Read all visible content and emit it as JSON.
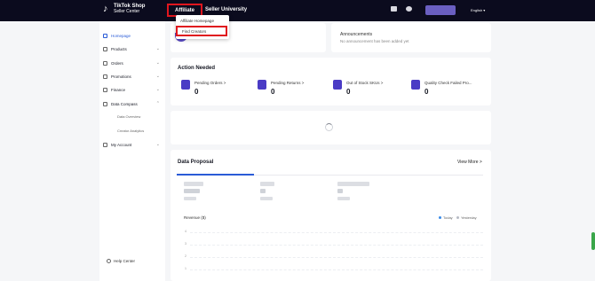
{
  "header": {
    "logo_line1": "TikTok Shop",
    "logo_line2": "Seller Center",
    "logo_mark": "♪",
    "nav": {
      "affiliate": "Affiliate",
      "seller_university": "Seller University"
    },
    "language": "English ▾"
  },
  "affiliate_menu": {
    "items": [
      "Affiliate Homepage",
      "Find Creators"
    ]
  },
  "sidebar": {
    "items": [
      {
        "label": "Homepage",
        "icon": "home-icon"
      },
      {
        "label": "Products",
        "icon": "products-icon"
      },
      {
        "label": "Orders",
        "icon": "orders-icon"
      },
      {
        "label": "Promotions",
        "icon": "promotions-icon"
      },
      {
        "label": "Finance",
        "icon": "finance-icon"
      },
      {
        "label": "Data Compass",
        "icon": "data-compass-icon"
      },
      {
        "label": "My Account",
        "icon": "account-icon"
      }
    ],
    "subitems": [
      "Data Overview",
      "Creator Analytics"
    ],
    "help": "Help Center"
  },
  "announcements": {
    "title": "Announcements",
    "empty_text": "No announcement has been added yet"
  },
  "action_needed": {
    "title": "Action Needed",
    "items": [
      {
        "label": "Pending Orders >",
        "value": "0"
      },
      {
        "label": "Pending Returns >",
        "value": "0"
      },
      {
        "label": "Out of Stock SKUs >",
        "value": "0"
      },
      {
        "label": "Quality Check Failed Pro...",
        "value": "0"
      }
    ]
  },
  "data_proposal": {
    "title": "Data Proposal",
    "view_more": "View More >",
    "revenue_label": "Revenue ($)",
    "legend": [
      "Today",
      "Yesterday"
    ],
    "y_ticks": [
      "4",
      "3",
      "2",
      "1"
    ],
    "colors": {
      "today": "#3a8be8",
      "yesterday": "#b6bac4"
    }
  }
}
